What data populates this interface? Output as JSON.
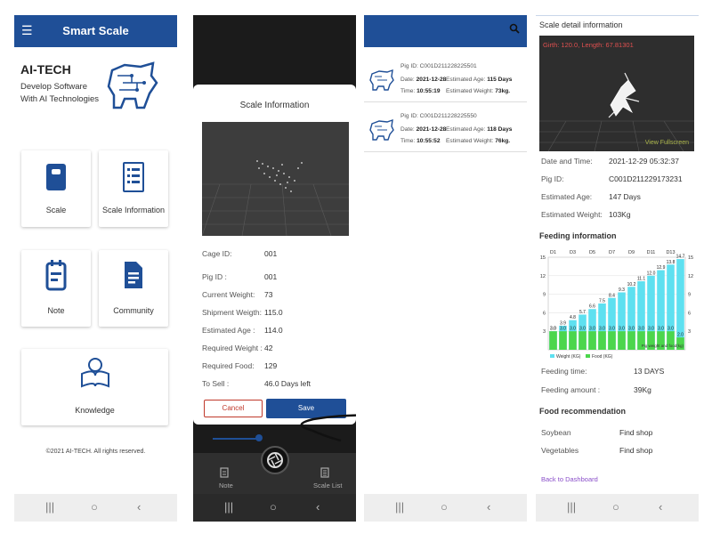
{
  "home": {
    "title": "Smart Scale",
    "brand": "AI-TECH",
    "tagline1": "Develop Software",
    "tagline2": "With AI Technologies",
    "cards": [
      "Scale",
      "Scale Information",
      "Note",
      "Community",
      "Knowledge"
    ],
    "copyright": "©2021 AI-TECH. All rights reserved."
  },
  "scale_info": {
    "title": "Scale Information",
    "fields": [
      {
        "label": "Cage ID:",
        "value": "001"
      },
      {
        "label": "Pig ID :",
        "value": "001"
      },
      {
        "label": "Current Weight:",
        "value": "73"
      },
      {
        "label": "Shipment Weigth:",
        "value": "115.0"
      },
      {
        "label": "Estimated Age :",
        "value": "114.0"
      },
      {
        "label": "Required Weight :",
        "value": "42"
      },
      {
        "label": "Required Food:",
        "value": "129"
      },
      {
        "label": "To Sell :",
        "value": "46.0 Days left"
      }
    ],
    "cancel_label": "Cancel",
    "save_label": "Save",
    "nav_note": "Note",
    "nav_scale_list": "Scale List"
  },
  "scale_list": {
    "items": [
      {
        "pig_id_label": "Pig ID:",
        "pig_id": "C001D211228225501",
        "date_label": "Date:",
        "date": "2021-12-28",
        "age_label": "Estimated Age:",
        "age": "115 Days",
        "time_label": "Time:",
        "time": "10:55:19",
        "weight_label": "Estimated Weight:",
        "weight": "73kg."
      },
      {
        "pig_id_label": "Pig ID:",
        "pig_id": "C001D211228225550",
        "date_label": "Date:",
        "date": "2021-12-28",
        "age_label": "Estimated Age:",
        "age": "118 Days",
        "time_label": "Time:",
        "time": "10:55:52",
        "weight_label": "Estimated Weight:",
        "weight": "76kg."
      }
    ]
  },
  "detail": {
    "title": "Scale detail information",
    "overlay": "Girth: 120.0, Length: 67.81301",
    "fullscreen": "View Fullscreen",
    "rows": [
      {
        "label": "Date and Time:",
        "value": "2021-12-29 05:32:37"
      },
      {
        "label": "Pig ID:",
        "value": "C001D211229173231"
      },
      {
        "label": "Estimated Age:",
        "value": "147 Days"
      },
      {
        "label": "Estimated Weight:",
        "value": "103Kg"
      }
    ],
    "feeding_title": "Feeding information",
    "feeding_rows": [
      {
        "label": "Feeding time:",
        "value": "13 DAYS"
      },
      {
        "label": "Feeding amount :",
        "value": "39Kg"
      }
    ],
    "food_title": "Food recommendation",
    "food_rows": [
      {
        "label": "Soybean",
        "link": "Find shop"
      },
      {
        "label": "Vegetables",
        "link": "Find shop"
      }
    ],
    "back": "Back to Dashboard"
  },
  "chart_data": {
    "type": "bar",
    "categories": [
      "D1",
      "D2",
      "D3",
      "D4",
      "D5",
      "D6",
      "D7",
      "D8",
      "D9",
      "D10",
      "D11",
      "D12",
      "D13"
    ],
    "x_tick_labels": [
      "D1",
      "D3",
      "D5",
      "D7",
      "D9",
      "D11",
      "D13"
    ],
    "series": [
      {
        "name": "Weight (KG)",
        "color": "#5ee0f0",
        "values": [
          3.0,
          3.9,
          4.8,
          5.7,
          6.6,
          7.5,
          8.4,
          9.3,
          10.2,
          11.1,
          12.0,
          12.9,
          13.8,
          14.7
        ]
      },
      {
        "name": "Food (KG)",
        "color": "#4cd64c",
        "values": [
          3.0,
          3.0,
          3.0,
          3.0,
          3.0,
          3.0,
          3.0,
          3.0,
          3.0,
          3.0,
          3.0,
          3.0,
          3.0,
          2.0
        ]
      }
    ],
    "ylim": [
      0,
      15
    ],
    "yticks": [
      3,
      6,
      9,
      12,
      15
    ],
    "annotation": "Pig weight and food(kg)",
    "legend": "bottom-left"
  },
  "colors": {
    "primary": "#1f4f97",
    "weight": "#5ee0f0",
    "food": "#4cd64c",
    "danger": "#c0392b"
  }
}
